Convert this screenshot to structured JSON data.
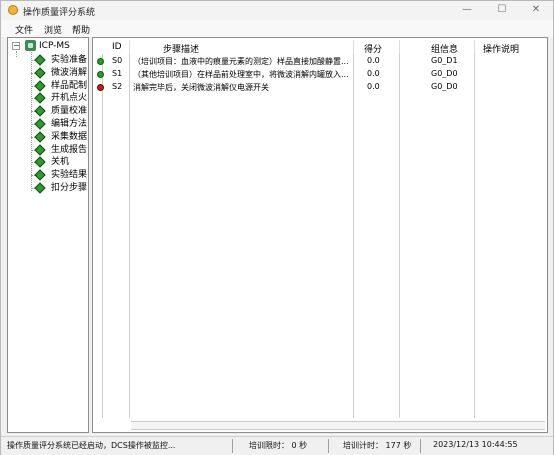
{
  "window": {
    "title": "操作质量评分系统",
    "controls": {
      "minimize": "—",
      "maximize": "☐",
      "close": "✕"
    }
  },
  "menu": [
    "文件",
    "浏览",
    "帮助"
  ],
  "tree": {
    "root": "ICP-MS",
    "items": [
      "实验准备",
      "微波消解",
      "样品配制",
      "开机点火",
      "质量校准",
      "编辑方法",
      "采集数据",
      "生成报告",
      "关机",
      "实验结果",
      "扣分步骤"
    ]
  },
  "table": {
    "columns": [
      "ID",
      "步骤描述",
      "得分",
      "组信息",
      "操作说明"
    ],
    "rows": [
      {
        "status": "green",
        "id": "S0",
        "desc": "（培训项目：血液中的痕量元素的测定）样品直接加酸静置...",
        "score": "0.0",
        "group": "G0_D1",
        "note": ""
      },
      {
        "status": "green",
        "id": "S1",
        "desc": "（其他培训项目）在样品前处理室中，将微波消解内罐放入...",
        "score": "0.0",
        "group": "G0_D0",
        "note": ""
      },
      {
        "status": "red",
        "id": "S2",
        "desc": "消解完毕后，关闭微波消解仪电源开关",
        "score": "0.0",
        "group": "G0_D0",
        "note": ""
      }
    ]
  },
  "status": {
    "message": "操作质量评分系统已经启动，DCS操作被监控...",
    "limit": "培训限时： 0 秒",
    "elapsed": "培训计时： 177 秒",
    "datetime": "2023/12/13 10:44:55"
  },
  "colors": {
    "green_dot": "#21a321",
    "red_dot": "#c41a1a",
    "tree_icon": "#2f9a2f"
  }
}
